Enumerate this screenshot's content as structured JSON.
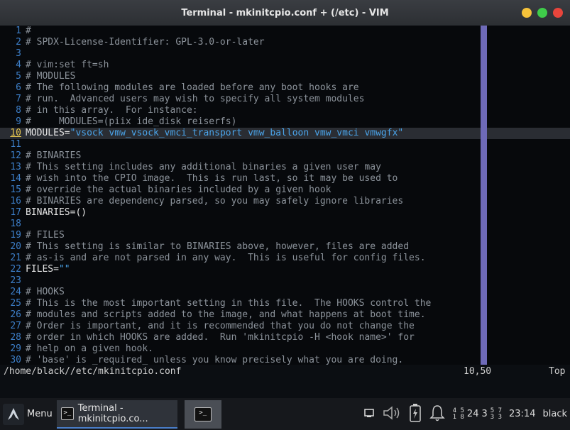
{
  "window": {
    "title": "Terminal - mkinitcpio.conf + (/etc) - VIM"
  },
  "editor": {
    "lines": [
      {
        "n": "1",
        "text": "#"
      },
      {
        "n": "2",
        "text": "# SPDX-License-Identifier: GPL-3.0-or-later"
      },
      {
        "n": "3",
        "text": ""
      },
      {
        "n": "4",
        "text": "# vim:set ft=sh"
      },
      {
        "n": "5",
        "text": "# MODULES"
      },
      {
        "n": "6",
        "text": "# The following modules are loaded before any boot hooks are"
      },
      {
        "n": "7",
        "text": "# run.  Advanced users may wish to specify all system modules"
      },
      {
        "n": "8",
        "text": "# in this array.  For instance:"
      },
      {
        "n": "9",
        "text": "#     MODULES=(piix ide_disk reiserfs)"
      },
      {
        "n": "10",
        "text_prefix": "MODULES=",
        "text_string": "\"vsock vmw_vsock_vmci_transport vmw_balloon vmw_vmci vmwgfx\"",
        "current": true
      },
      {
        "n": "11",
        "text": ""
      },
      {
        "n": "12",
        "text": "# BINARIES"
      },
      {
        "n": "13",
        "text": "# This setting includes any additional binaries a given user may"
      },
      {
        "n": "14",
        "text": "# wish into the CPIO image.  This is run last, so it may be used to"
      },
      {
        "n": "15",
        "text": "# override the actual binaries included by a given hook"
      },
      {
        "n": "16",
        "text": "# BINARIES are dependency parsed, so you may safely ignore libraries"
      },
      {
        "n": "17",
        "text": "BINARIES=()",
        "code": true
      },
      {
        "n": "18",
        "text": ""
      },
      {
        "n": "19",
        "text": "# FILES"
      },
      {
        "n": "20",
        "text": "# This setting is similar to BINARIES above, however, files are added"
      },
      {
        "n": "21",
        "text": "# as-is and are not parsed in any way.  This is useful for config files."
      },
      {
        "n": "22",
        "text_prefix": "FILES=",
        "text_string": "\"\""
      },
      {
        "n": "23",
        "text": ""
      },
      {
        "n": "24",
        "text": "# HOOKS"
      },
      {
        "n": "25",
        "text": "# This is the most important setting in this file.  The HOOKS control the"
      },
      {
        "n": "26",
        "text": "# modules and scripts added to the image, and what happens at boot time."
      },
      {
        "n": "27",
        "text": "# Order is important, and it is recommended that you do not change the"
      },
      {
        "n": "28",
        "text": "# order in which HOOKS are added.  Run 'mkinitcpio -H <hook name>' for"
      },
      {
        "n": "29",
        "text": "# help on a given hook."
      },
      {
        "n": "30",
        "text": "# 'base' is _required_ unless you know precisely what you are doing."
      }
    ]
  },
  "statusline": {
    "path": "/home/black//etc/mkinitcpio.conf",
    "position": "10,50",
    "scroll": "Top"
  },
  "taskbar": {
    "menu_label": "Menu",
    "task_label": "Terminal - mkinitcpio.co...",
    "workspace_top": "24",
    "workspace_mid": "3",
    "clock": "23:14",
    "user": "black"
  },
  "colors": {
    "line_number": "#3d7fc9",
    "string": "#4aa3e8",
    "color_column": "#6e6ab8",
    "close": "#f2a33a",
    "maximize": "#3fcc4a",
    "minimize": "#f5c23a",
    "close_red": "#e8453c"
  }
}
